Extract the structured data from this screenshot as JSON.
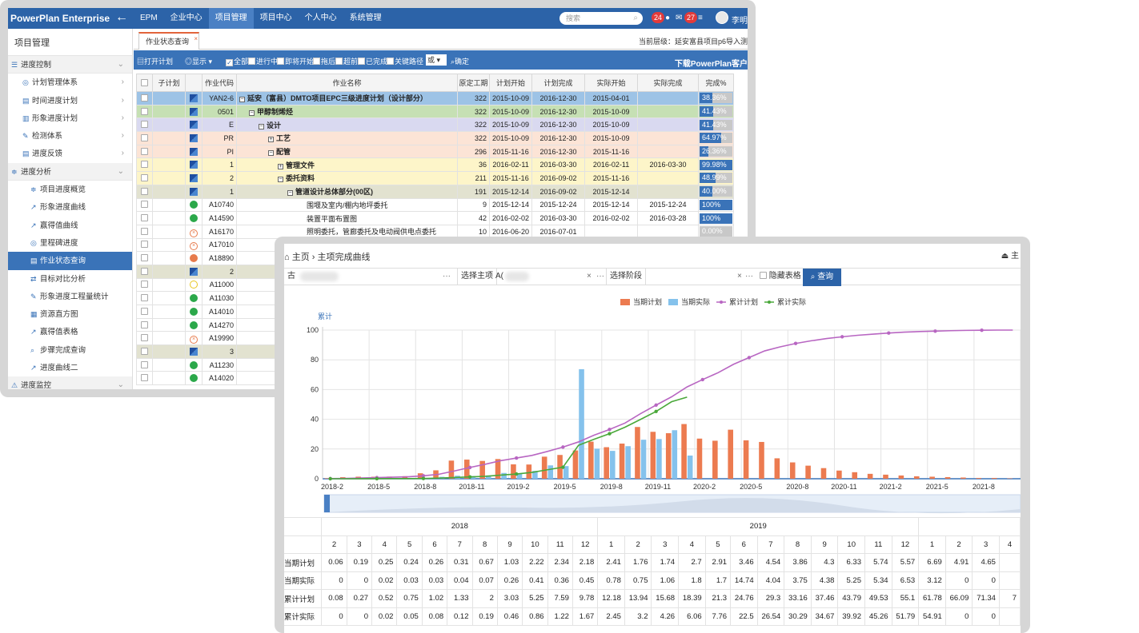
{
  "topbar": {
    "logo": "PowerPlan Enterprise",
    "nav": [
      "EPM",
      "企业中心",
      "项目管理",
      "项目中心",
      "个人中心",
      "系统管理"
    ],
    "active_nav": 2,
    "search_placeholder": "搜索",
    "badge_alerts": "24",
    "badge_messages": "27",
    "user_name": "李明"
  },
  "sidebar": {
    "title": "项目管理",
    "items": [
      {
        "label": "进度控制",
        "level": 0,
        "icon": "menu-icon",
        "chevron": "⌄"
      },
      {
        "label": "计划管理体系",
        "level": 1,
        "icon": "target-icon",
        "chevron": "›"
      },
      {
        "label": "时间进度计划",
        "level": 1,
        "icon": "list-icon",
        "chevron": "›"
      },
      {
        "label": "形象进度计划",
        "level": 1,
        "icon": "chart-icon",
        "chevron": "›"
      },
      {
        "label": "检测体系",
        "level": 1,
        "icon": "wrench-icon",
        "chevron": "›"
      },
      {
        "label": "进度反馈",
        "level": 1,
        "icon": "list-icon",
        "chevron": "›"
      },
      {
        "label": "进度分析",
        "level": 0,
        "icon": "sliders-icon",
        "chevron": "⌄"
      },
      {
        "label": "项目进度概览",
        "level": 2,
        "icon": "sliders-icon"
      },
      {
        "label": "形象进度曲线",
        "level": 2,
        "icon": "line-chart-icon"
      },
      {
        "label": "赢得值曲线",
        "level": 2,
        "icon": "line-chart-icon"
      },
      {
        "label": "里程碑进度",
        "level": 2,
        "icon": "target-icon"
      },
      {
        "label": "作业状态查询",
        "level": 2,
        "icon": "list-icon",
        "active": true
      },
      {
        "label": "目标对比分析",
        "level": 2,
        "icon": "swap-icon"
      },
      {
        "label": "形象进度工程量统计",
        "level": 2,
        "icon": "wrench-icon"
      },
      {
        "label": "资源直方图",
        "level": 2,
        "icon": "bar-chart-icon"
      },
      {
        "label": "赢得值表格",
        "level": 2,
        "icon": "line-chart-icon"
      },
      {
        "label": "步骤完成查询",
        "level": 2,
        "icon": "search-icon"
      },
      {
        "label": "进度曲线二",
        "level": 2,
        "icon": "line-chart-icon"
      },
      {
        "label": "进度监控",
        "level": 0,
        "icon": "warning-icon",
        "chevron": "⌄"
      }
    ]
  },
  "main1": {
    "tab_label": "作业状态查询",
    "current_level": "当前层级：延安富县项目p6导入测",
    "toolbar": {
      "open_plan": "打开计划",
      "display": "显示",
      "filters": [
        {
          "label": "全部",
          "checked": true
        },
        {
          "label": "进行中",
          "checked": false
        },
        {
          "label": "即将开始",
          "checked": false
        },
        {
          "label": "拖后",
          "checked": false
        },
        {
          "label": "超前",
          "checked": false
        },
        {
          "label": "已完成",
          "checked": false
        },
        {
          "label": "关键路径",
          "checked": false
        }
      ],
      "logic": "或",
      "confirm": "确定",
      "download": "下载PowerPlan客户端"
    },
    "columns": [
      "子计划",
      "作业代码",
      "作业名称",
      "原定工期",
      "计划开始",
      "计划完成",
      "实际开始",
      "实际完成",
      "完成%"
    ],
    "rows": [
      {
        "bg": "#9dc3e6",
        "status": "wbs",
        "code": "YAN2-6",
        "name": "延安（富县）DMTO项目EPC三级进度计划（设计部分）",
        "indent": 0,
        "tgl": "⊟",
        "bold": true,
        "dur": "322",
        "ps": "2015-10-09",
        "pf": "2016-12-30",
        "as": "2015-04-01",
        "af": "",
        "pct": 38.36
      },
      {
        "bg": "#c6e0b4",
        "status": "wbs",
        "code": "0501",
        "name": "甲醇制烯烃",
        "indent": 1,
        "tgl": "⊟",
        "bold": true,
        "dur": "322",
        "ps": "2015-10-09",
        "pf": "2016-12-30",
        "as": "2015-10-09",
        "af": "",
        "pct": 41.43
      },
      {
        "bg": "#d9d9f0",
        "status": "wbs",
        "code": "E",
        "name": "设计",
        "indent": 2,
        "tgl": "⊟",
        "bold": true,
        "dur": "322",
        "ps": "2015-10-09",
        "pf": "2016-12-30",
        "as": "2015-10-09",
        "af": "",
        "pct": 41.43
      },
      {
        "bg": "#fce4d6",
        "status": "wbs",
        "code": "PR",
        "name": "工艺",
        "indent": 3,
        "tgl": "⊞",
        "bold": true,
        "dur": "322",
        "ps": "2015-10-09",
        "pf": "2016-12-30",
        "as": "2015-10-09",
        "af": "",
        "pct": 64.97
      },
      {
        "bg": "#fce4d6",
        "status": "wbs",
        "code": "PI",
        "name": "配管",
        "indent": 3,
        "tgl": "⊟",
        "bold": true,
        "dur": "296",
        "ps": "2015-11-16",
        "pf": "2016-12-30",
        "as": "2015-11-16",
        "af": "",
        "pct": 26.36
      },
      {
        "bg": "#fdf5c9",
        "status": "wbs",
        "code": "1",
        "name": "管理文件",
        "indent": 4,
        "tgl": "⊞",
        "bold": true,
        "dur": "36",
        "ps": "2016-02-11",
        "pf": "2016-03-30",
        "as": "2016-02-11",
        "af": "2016-03-30",
        "pct": 99.98
      },
      {
        "bg": "#fdf5c9",
        "status": "wbs",
        "code": "2",
        "name": "委托资料",
        "indent": 4,
        "tgl": "⊟",
        "bold": true,
        "dur": "211",
        "ps": "2015-11-16",
        "pf": "2016-09-02",
        "as": "2015-11-16",
        "af": "",
        "pct": 48.99
      },
      {
        "bg": "#e2e2d0",
        "status": "wbs",
        "code": "1",
        "name": "管道设计总体部分(00区)",
        "indent": 5,
        "tgl": "⊟",
        "bold": true,
        "dur": "191",
        "ps": "2015-12-14",
        "pf": "2016-09-02",
        "as": "2015-12-14",
        "af": "",
        "pct": 40.0
      },
      {
        "bg": "#ffffff",
        "status": "green",
        "code": "A10740",
        "name": "围堰及室内/棚内地坪委托",
        "indent": 7,
        "tgl": "",
        "bold": false,
        "dur": "9",
        "ps": "2015-12-14",
        "pf": "2015-12-24",
        "as": "2015-12-14",
        "af": "2015-12-24",
        "pct": 100
      },
      {
        "bg": "#ffffff",
        "status": "green",
        "code": "A14590",
        "name": "装置平面布置图",
        "indent": 7,
        "tgl": "",
        "bold": false,
        "dur": "42",
        "ps": "2016-02-02",
        "pf": "2016-03-30",
        "as": "2016-02-02",
        "af": "2016-03-28",
        "pct": 100
      },
      {
        "bg": "#ffffff",
        "status": "cancel",
        "code": "A16170",
        "name": "照明委托，管廊委托及电动阀供电点委托",
        "indent": 7,
        "tgl": "",
        "bold": false,
        "dur": "10",
        "ps": "2016-06-20",
        "pf": "2016-07-01",
        "as": "",
        "af": "",
        "pct": 0
      },
      {
        "bg": "#ffffff",
        "status": "cancel",
        "code": "A17010",
        "name": "",
        "indent": 7,
        "tgl": "",
        "bold": false,
        "dur": "",
        "ps": "",
        "pf": "",
        "as": "",
        "af": "",
        "pct": null
      },
      {
        "bg": "#ffffff",
        "status": "orange",
        "code": "A18890",
        "name": "",
        "indent": 7,
        "tgl": "",
        "bold": false,
        "dur": "",
        "ps": "",
        "pf": "",
        "as": "",
        "af": "",
        "pct": null
      },
      {
        "bg": "#e2e2d0",
        "status": "wbs",
        "code": "2",
        "name": "",
        "indent": 5,
        "tgl": "",
        "bold": true,
        "dur": "",
        "ps": "",
        "pf": "",
        "as": "",
        "af": "",
        "pct": null
      },
      {
        "bg": "#ffffff",
        "status": "yellow",
        "code": "A11000",
        "name": "",
        "indent": 7,
        "tgl": "",
        "bold": false,
        "dur": "",
        "ps": "",
        "pf": "",
        "as": "",
        "af": "",
        "pct": null
      },
      {
        "bg": "#ffffff",
        "status": "green",
        "code": "A11030",
        "name": "",
        "indent": 7,
        "tgl": "",
        "bold": false,
        "dur": "",
        "ps": "",
        "pf": "",
        "as": "",
        "af": "",
        "pct": null
      },
      {
        "bg": "#ffffff",
        "status": "green",
        "code": "A14010",
        "name": "",
        "indent": 7,
        "tgl": "",
        "bold": false,
        "dur": "",
        "ps": "",
        "pf": "",
        "as": "",
        "af": "",
        "pct": null
      },
      {
        "bg": "#ffffff",
        "status": "green",
        "code": "A14270",
        "name": "",
        "indent": 7,
        "tgl": "",
        "bold": false,
        "dur": "",
        "ps": "",
        "pf": "",
        "as": "",
        "af": "",
        "pct": null
      },
      {
        "bg": "#ffffff",
        "status": "cancel",
        "code": "A19990",
        "name": "",
        "indent": 7,
        "tgl": "",
        "bold": false,
        "dur": "",
        "ps": "",
        "pf": "",
        "as": "",
        "af": "",
        "pct": null
      },
      {
        "bg": "#e2e2d0",
        "status": "wbs",
        "code": "3",
        "name": "",
        "indent": 5,
        "tgl": "",
        "bold": true,
        "dur": "",
        "ps": "",
        "pf": "",
        "as": "",
        "af": "",
        "pct": null
      },
      {
        "bg": "#ffffff",
        "status": "green",
        "code": "A11230",
        "name": "",
        "indent": 7,
        "tgl": "",
        "bold": false,
        "dur": "",
        "ps": "",
        "pf": "",
        "as": "",
        "af": "",
        "pct": null
      },
      {
        "bg": "#ffffff",
        "status": "green",
        "code": "A14020",
        "name": "",
        "indent": 7,
        "tgl": "",
        "bold": false,
        "dur": "",
        "ps": "",
        "pf": "",
        "as": "",
        "af": "",
        "pct": null
      }
    ]
  },
  "win2": {
    "breadcrumb": "⌂ 主页 › 主项完成曲线",
    "right_label": "⏏ 主",
    "filter": {
      "prefix": "古",
      "select_item": "选择主项",
      "item_prefix": "A(",
      "select_stage": "选择阶段",
      "hide_table": "隐藏表格",
      "query": "查询"
    }
  },
  "chart_data": {
    "type": "bar",
    "ylabel": "累计",
    "ylim": [
      0,
      100
    ],
    "yticks": [
      0,
      20,
      40,
      60,
      80,
      100
    ],
    "legend": [
      "当期计划",
      "当期实际",
      "累计计划",
      "累计实际"
    ],
    "legend_position": "top-right",
    "grid": true,
    "x_tick_labels": [
      "2018-2",
      "2018-5",
      "2018-8",
      "2018-11",
      "2019-2",
      "2019-5",
      "2019-8",
      "2019-11",
      "2020-2",
      "2020-5",
      "2020-8",
      "2020-11",
      "2021-2",
      "2021-5",
      "2021-8",
      "2"
    ],
    "x": [
      "2018-2",
      "2018-3",
      "2018-4",
      "2018-5",
      "2018-6",
      "2018-7",
      "2018-8",
      "2018-9",
      "2018-10",
      "2018-11",
      "2018-12",
      "2019-1",
      "2019-2",
      "2019-3",
      "2019-4",
      "2019-5",
      "2019-6",
      "2019-7",
      "2019-8",
      "2019-9",
      "2019-10",
      "2019-11",
      "2019-12",
      "2020-1",
      "2020-2",
      "2020-3",
      "2020-4",
      "2020-5",
      "2020-6",
      "2020-7",
      "2020-8",
      "2020-9",
      "2020-10",
      "2020-11",
      "2020-12",
      "2021-1",
      "2021-2",
      "2021-3",
      "2021-4",
      "2021-5",
      "2021-6",
      "2021-7",
      "2021-8",
      "2021-9",
      "2021-10"
    ],
    "series": [
      {
        "name": "当期计划",
        "color": "#ec7b50",
        "values": [
          0.06,
          0.19,
          0.25,
          0.24,
          0.26,
          0.31,
          0.67,
          1.03,
          2.22,
          2.34,
          2.18,
          2.41,
          1.76,
          1.74,
          2.7,
          2.91,
          3.46,
          4.54,
          3.86,
          4.3,
          6.33,
          5.74,
          5.57,
          6.69,
          4.91,
          4.65,
          6,
          4.7,
          4.5,
          2.5,
          2.0,
          1.6,
          1.3,
          1.0,
          0.8,
          0.6,
          0.5,
          0.4,
          0.3,
          0.25,
          0.2,
          0.15,
          0.1,
          0.1,
          0.05
        ]
      },
      {
        "name": "当期实际",
        "color": "#85c2ec",
        "values": [
          0,
          0,
          0.02,
          0.03,
          0.03,
          0.04,
          0.07,
          0.26,
          0.41,
          0.36,
          0.45,
          0.78,
          0.75,
          1.06,
          1.8,
          1.7,
          14.74,
          4.04,
          3.75,
          4.38,
          5.25,
          5.34,
          6.53,
          3.12,
          0,
          0,
          0,
          0,
          0,
          0,
          0,
          0,
          0,
          0,
          0,
          0,
          0,
          0,
          0,
          0,
          0,
          0,
          0,
          0,
          0
        ]
      },
      {
        "name": "累计计划",
        "color": "#b866c2",
        "values": [
          0.08,
          0.27,
          0.52,
          0.75,
          1.02,
          1.33,
          2,
          3.03,
          5.25,
          7.59,
          9.78,
          12.18,
          13.94,
          15.68,
          18.39,
          21.3,
          24.76,
          29.3,
          33.16,
          37.46,
          43.79,
          49.53,
          55.1,
          61.78,
          66.69,
          71.34,
          77,
          81.5,
          86,
          88.7,
          91,
          92.8,
          94.3,
          95.5,
          96.5,
          97.3,
          98,
          98.6,
          99,
          99.3,
          99.6,
          99.8,
          99.9,
          100,
          100
        ]
      },
      {
        "name": "累计实际",
        "color": "#4aa83a",
        "values": [
          0,
          0,
          0.02,
          0.05,
          0.08,
          0.12,
          0.19,
          0.46,
          0.86,
          1.22,
          1.67,
          2.45,
          3.2,
          4.26,
          6.06,
          7.76,
          22.5,
          26.54,
          30.29,
          34.67,
          39.92,
          45.26,
          51.79,
          54.91
        ]
      }
    ]
  },
  "datatable": {
    "years": [
      {
        "label": "2018",
        "span": 11
      },
      {
        "label": "2019",
        "span": 12
      },
      {
        "label": "",
        "span": 4
      }
    ],
    "months": [
      "2",
      "3",
      "4",
      "5",
      "6",
      "7",
      "8",
      "9",
      "10",
      "11",
      "12",
      "1",
      "2",
      "3",
      "4",
      "5",
      "6",
      "7",
      "8",
      "9",
      "10",
      "11",
      "12",
      "1",
      "2",
      "3",
      "4"
    ],
    "rows": [
      {
        "label": "当期计划",
        "values": [
          "0.06",
          "0.19",
          "0.25",
          "0.24",
          "0.26",
          "0.31",
          "0.67",
          "1.03",
          "2.22",
          "2.34",
          "2.18",
          "2.41",
          "1.76",
          "1.74",
          "2.7",
          "2.91",
          "3.46",
          "4.54",
          "3.86",
          "4.3",
          "6.33",
          "5.74",
          "5.57",
          "6.69",
          "4.91",
          "4.65",
          ""
        ]
      },
      {
        "label": "当期实际",
        "values": [
          "0",
          "0",
          "0.02",
          "0.03",
          "0.03",
          "0.04",
          "0.07",
          "0.26",
          "0.41",
          "0.36",
          "0.45",
          "0.78",
          "0.75",
          "1.06",
          "1.8",
          "1.7",
          "14.74",
          "4.04",
          "3.75",
          "4.38",
          "5.25",
          "5.34",
          "6.53",
          "3.12",
          "0",
          "0",
          ""
        ]
      },
      {
        "label": "累计计划",
        "values": [
          "0.08",
          "0.27",
          "0.52",
          "0.75",
          "1.02",
          "1.33",
          "2",
          "3.03",
          "5.25",
          "7.59",
          "9.78",
          "12.18",
          "13.94",
          "15.68",
          "18.39",
          "21.3",
          "24.76",
          "29.3",
          "33.16",
          "37.46",
          "43.79",
          "49.53",
          "55.1",
          "61.78",
          "66.09",
          "71.34",
          "7"
        ]
      },
      {
        "label": "累计实际",
        "values": [
          "0",
          "0",
          "0.02",
          "0.05",
          "0.08",
          "0.12",
          "0.19",
          "0.46",
          "0.86",
          "1.22",
          "1.67",
          "2.45",
          "3.2",
          "4.26",
          "6.06",
          "7.76",
          "22.5",
          "26.54",
          "30.29",
          "34.67",
          "39.92",
          "45.26",
          "51.79",
          "54.91",
          "0",
          "0",
          ""
        ]
      }
    ]
  }
}
